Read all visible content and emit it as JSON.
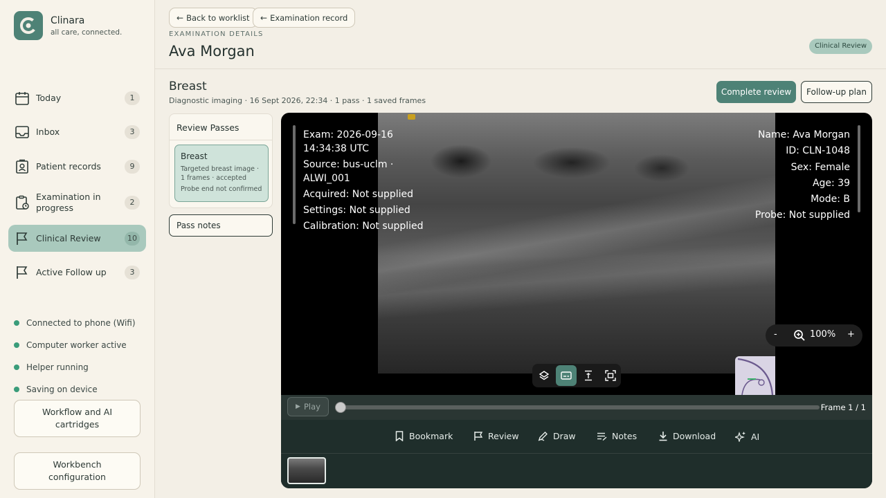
{
  "brand": {
    "name": "Clinara",
    "tagline": "all care, connected."
  },
  "sidebar": {
    "items": [
      {
        "label": "Today",
        "count": "1"
      },
      {
        "label": "Inbox",
        "count": "3"
      },
      {
        "label": "Patient records",
        "count": "9"
      },
      {
        "label": "Examination in progress",
        "count": "2"
      },
      {
        "label": "Clinical Review",
        "count": "10"
      },
      {
        "label": "Active Follow up",
        "count": "3"
      }
    ],
    "status": [
      "Connected to phone (Wifi)",
      "Computer worker active",
      "Helper running",
      "Saving on device"
    ],
    "buttons": {
      "workflow": "Workflow and AI cartridges",
      "workbench": "Workbench configuration"
    }
  },
  "header": {
    "back_worklist": "Back to worklist",
    "exam_record": "Examination record",
    "eyebrow": "EXAMINATION DETAILS",
    "patient_name": "Ava Morgan",
    "status_pill": "Clinical Review"
  },
  "study": {
    "title": "Breast",
    "meta": "Diagnostic imaging · 16 Sept 2026, 22:34 · 1 pass · 1 saved frames",
    "complete_review": "Complete review",
    "follow_up": "Follow-up plan"
  },
  "passes": {
    "heading": "Review Passes",
    "card": {
      "name": "Breast",
      "line1": "Targeted breast image ·",
      "line2": "1 frames · accepted",
      "note": "Probe end not confirmed"
    },
    "notes_button": "Pass notes"
  },
  "viewer": {
    "left_overlay": [
      "Exam: 2026-09-16",
      "14:34:38 UTC",
      "Source: bus-uclm ·",
      "ALWI_001",
      "Acquired: Not supplied",
      "Settings: Not supplied",
      "Calibration: Not supplied"
    ],
    "right_overlay": [
      "Name: Ava Morgan",
      "ID: CLN-1048",
      "Sex: Female",
      "Age: 39",
      "Mode: B",
      "Probe: Not supplied"
    ],
    "zoom": {
      "minus": "-",
      "value": "100%",
      "plus": "+"
    },
    "play": "Play",
    "frame": "Frame 1 / 1",
    "frame_position": 0,
    "actions": {
      "bookmark": "Bookmark",
      "review": "Review",
      "draw": "Draw",
      "notes": "Notes",
      "download": "Download",
      "ai": "AI"
    }
  },
  "colors": {
    "accent": "#4e8276",
    "accent_soft": "#a9c9bd",
    "status_dot": "#3a9c7a",
    "viewer_bar": "#1f2e2b"
  }
}
